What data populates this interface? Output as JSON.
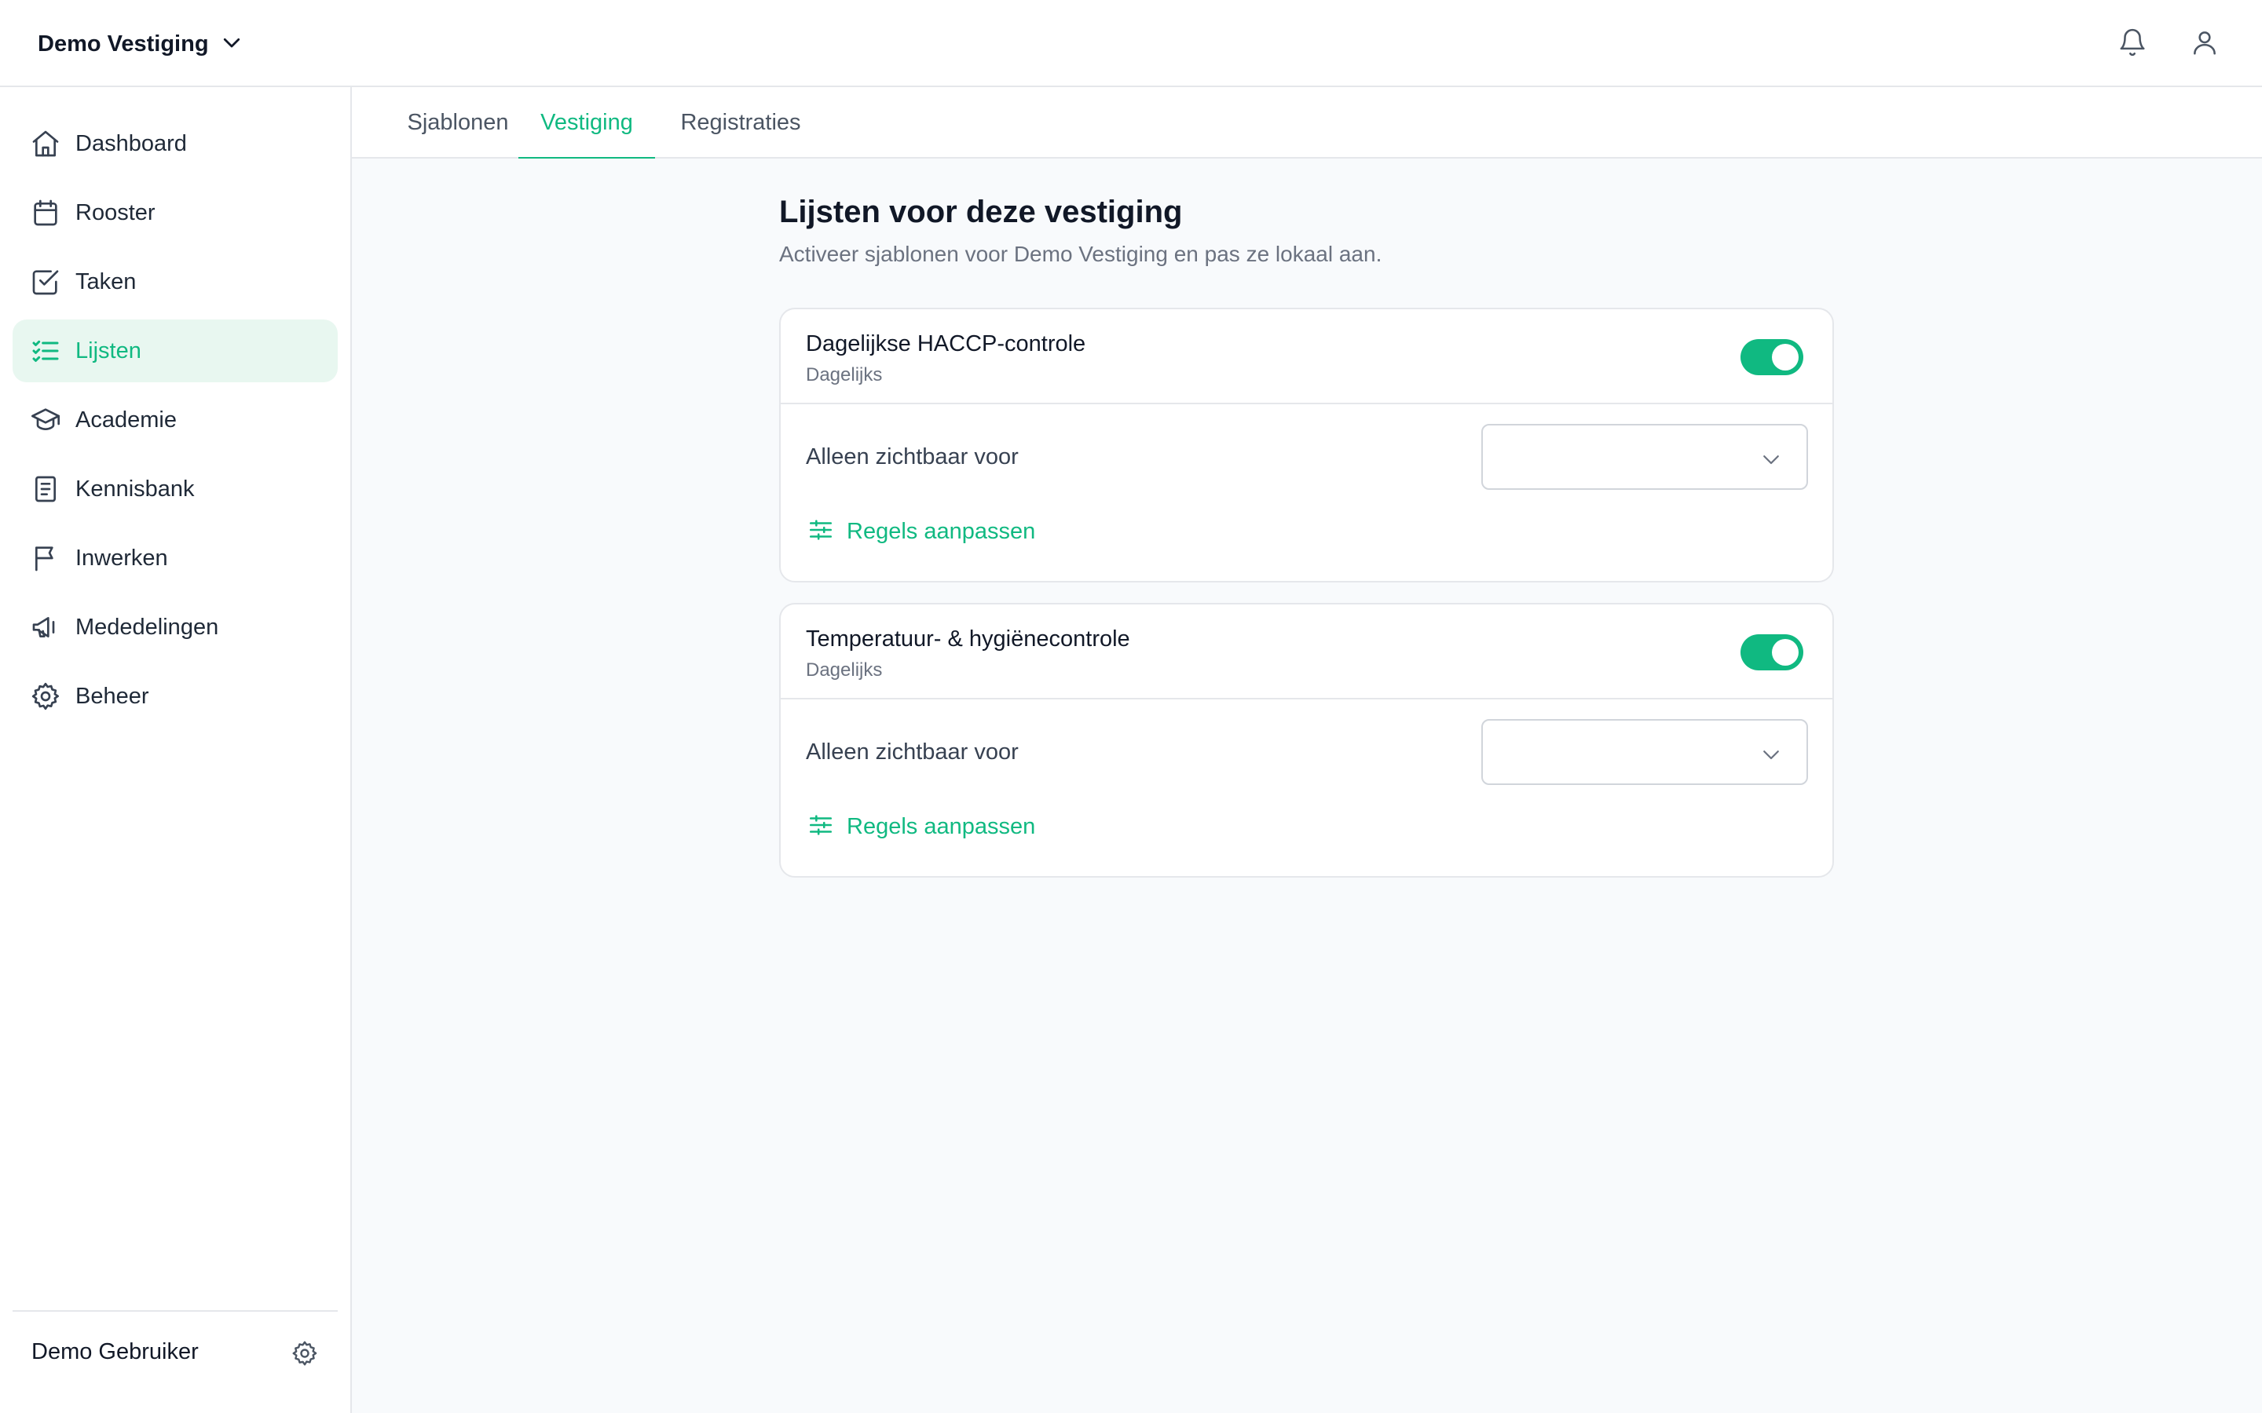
{
  "header": {
    "location_name": "Demo Vestiging",
    "icons": [
      "chevron-down-icon",
      "bell-icon",
      "user-icon"
    ]
  },
  "sidebar": {
    "items": [
      {
        "label": "Dashboard",
        "icon": "home-icon",
        "active": false
      },
      {
        "label": "Rooster",
        "icon": "calendar-icon",
        "active": false
      },
      {
        "label": "Taken",
        "icon": "checkbox-icon",
        "active": false
      },
      {
        "label": "Lijsten",
        "icon": "list-checks-icon",
        "active": true
      },
      {
        "label": "Academie",
        "icon": "graduation-cap-icon",
        "active": false
      },
      {
        "label": "Kennisbank",
        "icon": "book-icon",
        "active": false
      },
      {
        "label": "Inwerken",
        "icon": "flag-icon",
        "active": false
      },
      {
        "label": "Mededelingen",
        "icon": "megaphone-icon",
        "active": false
      },
      {
        "label": "Beheer",
        "icon": "gear-icon",
        "active": false
      }
    ],
    "user_name": "Demo Gebruiker"
  },
  "tabs": [
    {
      "label": "Sjablonen",
      "active": false
    },
    {
      "label": "Vestiging",
      "active": true
    },
    {
      "label": "Registraties",
      "active": false
    }
  ],
  "main": {
    "title": "Lijsten voor deze vestiging",
    "subtitle": "Activeer sjablonen voor Demo Vestiging en pas ze lokaal aan.",
    "cards": [
      {
        "title": "Dagelijkse HACCP-controle",
        "frequency": "Dagelijks",
        "enabled": true,
        "visibility_label": "Alleen zichtbaar voor",
        "visibility_value": "",
        "rules_link": "Regels aanpassen"
      },
      {
        "title": "Temperatuur- & hygiënecontrole",
        "frequency": "Dagelijks",
        "enabled": true,
        "visibility_label": "Alleen zichtbaar voor",
        "visibility_value": "",
        "rules_link": "Regels aanpassen"
      }
    ]
  },
  "colors": {
    "accent": "#10b981",
    "active_bg": "#e8f7f0",
    "main_bg": "#f8fafc",
    "border": "#e5e7eb"
  }
}
